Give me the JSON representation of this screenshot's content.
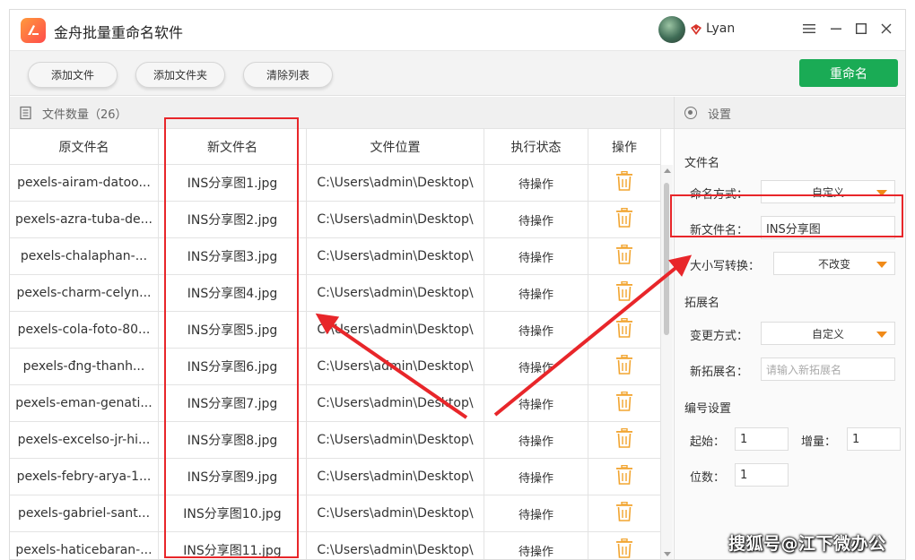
{
  "app": {
    "title": "金舟批量重命名软件",
    "username": "Lyan"
  },
  "toolbar": {
    "add_file": "添加文件",
    "add_folder": "添加文件夹",
    "clear_list": "清除列表",
    "rename": "重命名"
  },
  "file_panel": {
    "count_label": "文件数量（26）"
  },
  "table": {
    "headers": [
      "原文件名",
      "新文件名",
      "文件位置",
      "执行状态",
      "操作"
    ],
    "rows": [
      {
        "original": "pexels-airam-datoo...",
        "new": "INS分享图1.jpg",
        "location": "C:\\Users\\admin\\Desktop\\",
        "status": "待操作"
      },
      {
        "original": "pexels-azra-tuba-de...",
        "new": "INS分享图2.jpg",
        "location": "C:\\Users\\admin\\Desktop\\",
        "status": "待操作"
      },
      {
        "original": "pexels-chalaphan-...",
        "new": "INS分享图3.jpg",
        "location": "C:\\Users\\admin\\Desktop\\",
        "status": "待操作"
      },
      {
        "original": "pexels-charm-celyn...",
        "new": "INS分享图4.jpg",
        "location": "C:\\Users\\admin\\Desktop\\",
        "status": "待操作"
      },
      {
        "original": "pexels-cola-foto-80...",
        "new": "INS分享图5.jpg",
        "location": "C:\\Users\\admin\\Desktop\\",
        "status": "待操作"
      },
      {
        "original": "pexels-đng-thanh...",
        "new": "INS分享图6.jpg",
        "location": "C:\\Users\\admin\\Desktop\\",
        "status": "待操作"
      },
      {
        "original": "pexels-eman-genati...",
        "new": "INS分享图7.jpg",
        "location": "C:\\Users\\admin\\Desktop\\",
        "status": "待操作"
      },
      {
        "original": "pexels-excelso-jr-hi...",
        "new": "INS分享图8.jpg",
        "location": "C:\\Users\\admin\\Desktop\\",
        "status": "待操作"
      },
      {
        "original": "pexels-febry-arya-1...",
        "new": "INS分享图9.jpg",
        "location": "C:\\Users\\admin\\Desktop\\",
        "status": "待操作"
      },
      {
        "original": "pexels-gabriel-sant...",
        "new": "INS分享图10.jpg",
        "location": "C:\\Users\\admin\\Desktop\\",
        "status": "待操作"
      },
      {
        "original": "pexels-haticebaran-...",
        "new": "INS分享图11.jpg",
        "location": "C:\\Users\\admin\\Desktop\\",
        "status": "待操作"
      }
    ]
  },
  "settings": {
    "title": "设置",
    "filename_section": "文件名",
    "naming_method_label": "命名方式：",
    "naming_method_value": "自定义",
    "new_filename_label": "新文件名：",
    "new_filename_value": "INS分享图",
    "case_label": "大小写转换：",
    "case_value": "不改变",
    "ext_section": "拓展名",
    "change_method_label": "变更方式：",
    "change_method_value": "自定义",
    "new_ext_label": "新拓展名：",
    "new_ext_placeholder": "请输入新拓展名",
    "numbering_section": "编号设置",
    "start_label": "起始：",
    "start_value": "1",
    "increment_label": "增量：",
    "increment_value": "1",
    "digits_label": "位数：",
    "digits_value": "1"
  },
  "watermark": "搜狐号@江下微办公",
  "colors": {
    "accent_green": "#1aab55",
    "annotation_red": "#e8262a",
    "dropdown_caret": "#f08a18",
    "trash_icon": "#f2a531"
  }
}
